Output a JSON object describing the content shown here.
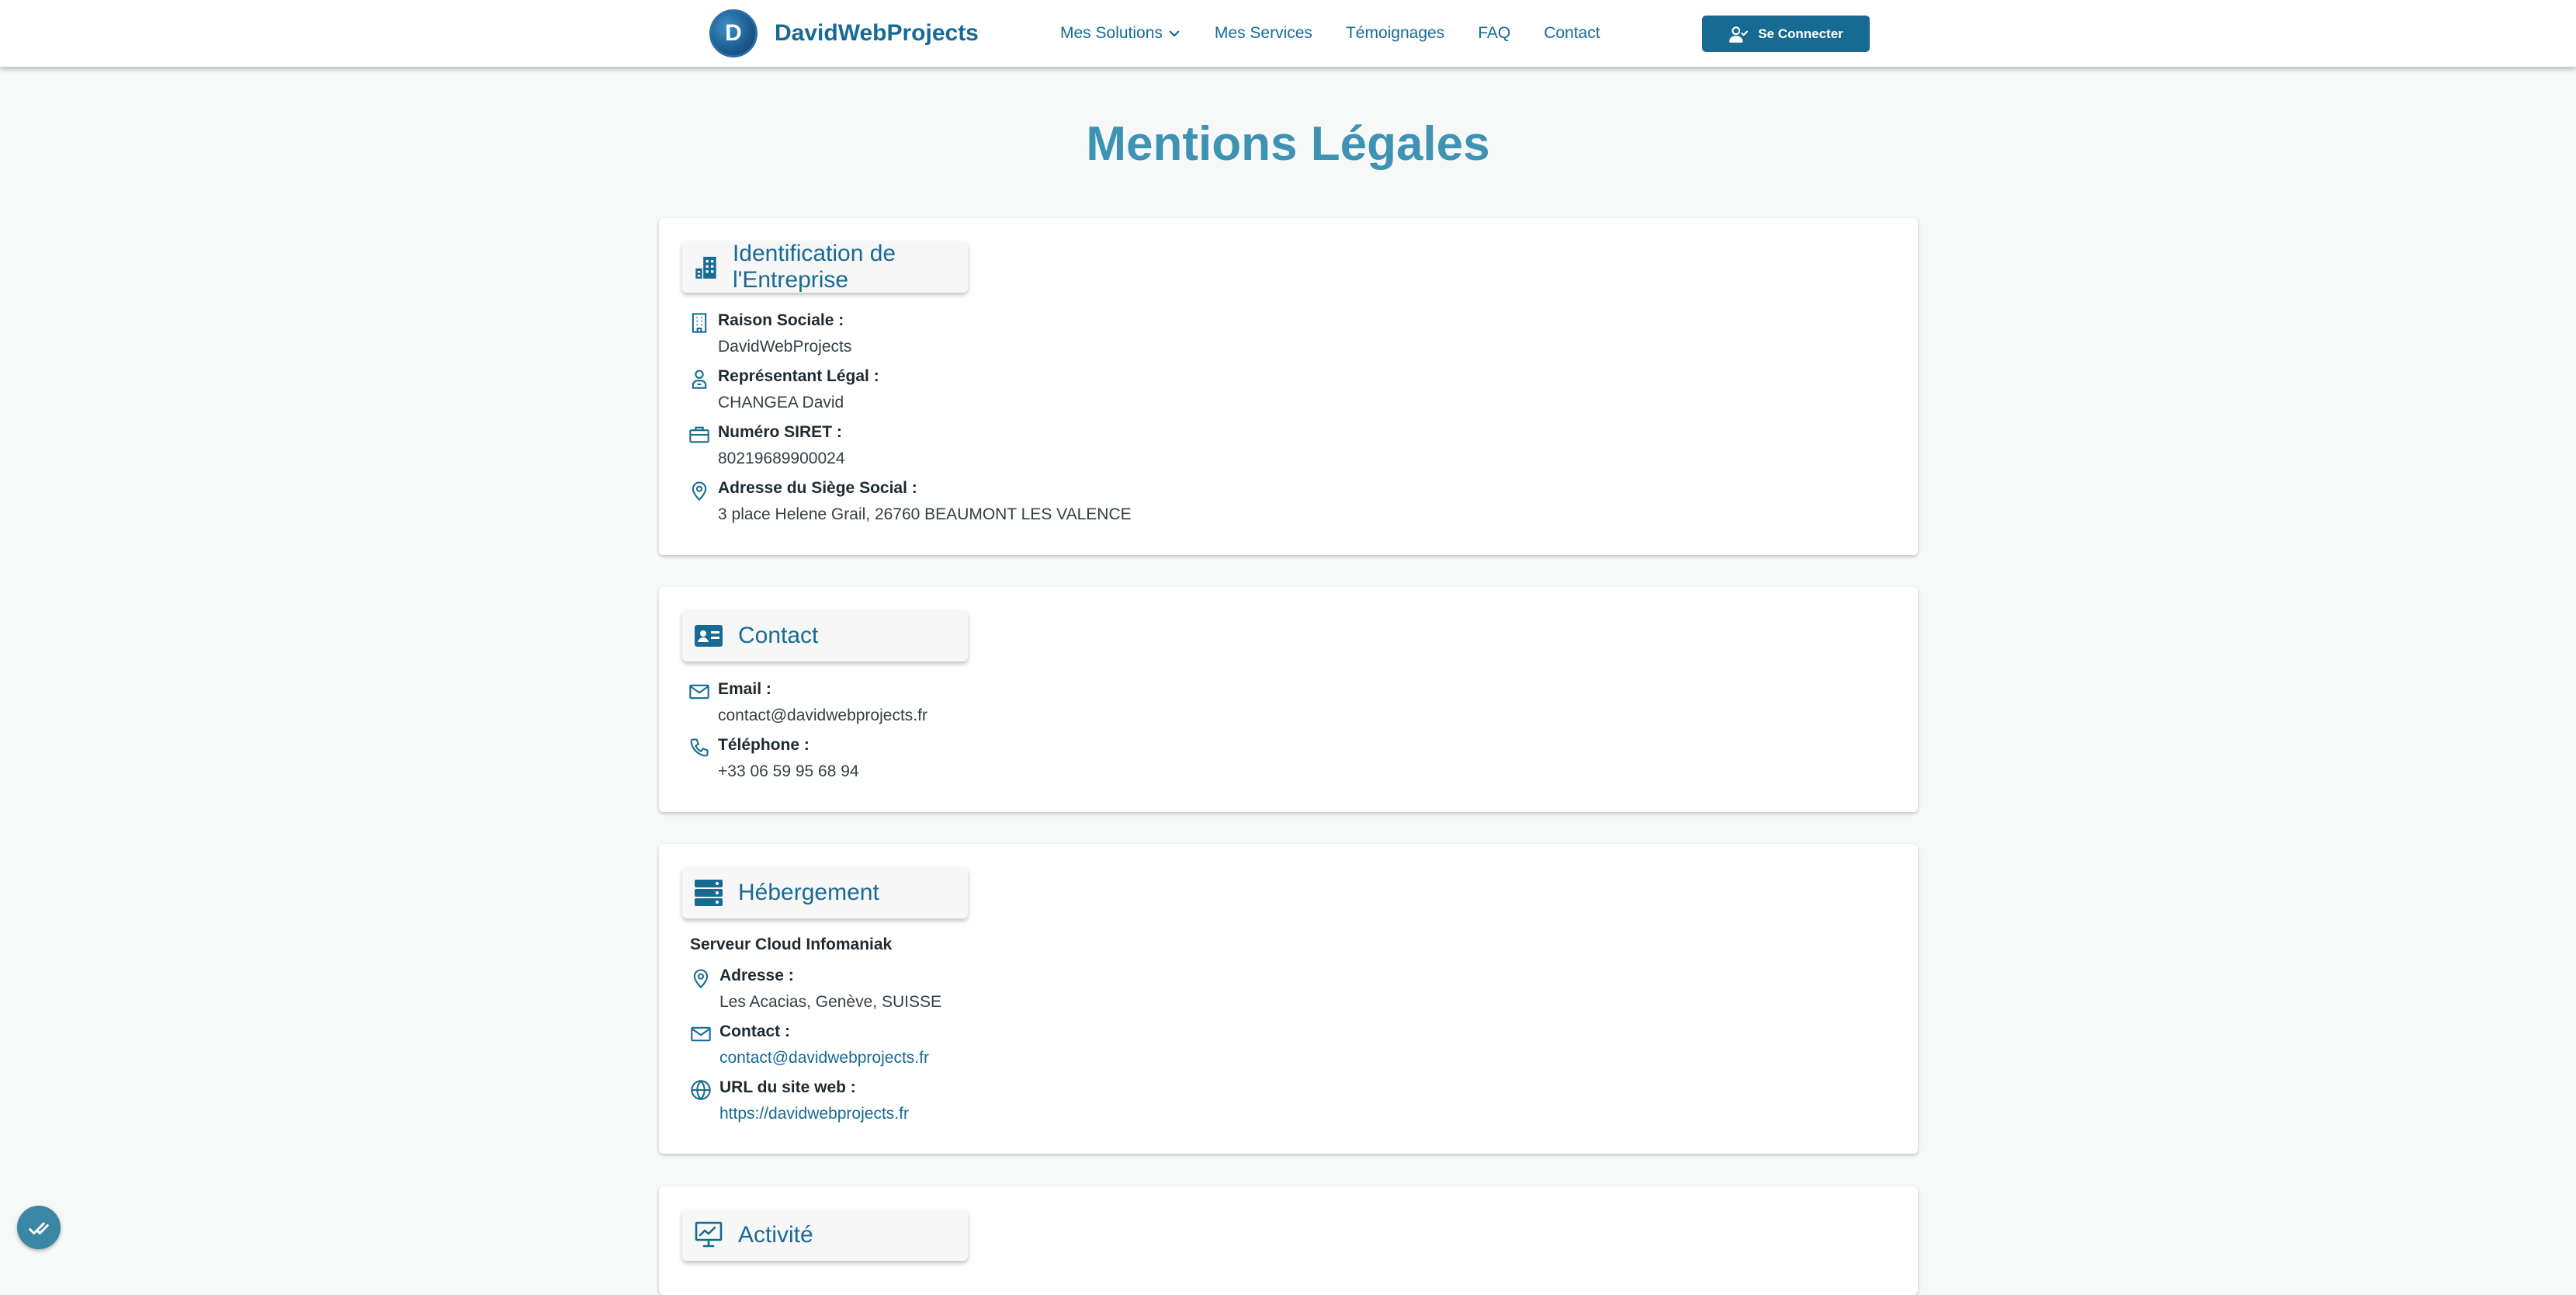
{
  "header": {
    "brand": "DavidWebProjects",
    "logo_letter": "D",
    "nav": {
      "solutions": "Mes Solutions",
      "services": "Mes Services",
      "testimonials": "Témoignages",
      "faq": "FAQ",
      "contact": "Contact"
    },
    "login_label": "Se Connecter"
  },
  "page": {
    "title": "Mentions Légales"
  },
  "identification": {
    "title": "Identification de l'Entreprise",
    "icon": "building-icon",
    "raison_label": "Raison Sociale :",
    "raison_value": "DavidWebProjects",
    "rep_label": "Représentant Légal :",
    "rep_value": "CHANGEA David",
    "siret_label": "Numéro SIRET :",
    "siret_value": "80219689900024",
    "address_label": "Adresse du Siège Social :",
    "address_value": "3 place Helene Grail, 26760 BEAUMONT LES VALENCE"
  },
  "contact": {
    "title": "Contact",
    "icon": "contact-card-icon",
    "email_label": "Email :",
    "email_value": "contact@davidwebprojects.fr",
    "phone_label": "Téléphone :",
    "phone_value": "+33 06 59 95 68 94"
  },
  "hosting": {
    "title": "Hébergement",
    "icon": "server-icon",
    "provider": "Serveur Cloud Infomaniak",
    "address_label": "Adresse :",
    "address_value": "Les Acacias, Genève, SUISSE",
    "contact_label": "Contact :",
    "contact_value": "contact@davidwebprojects.fr",
    "url_label": "URL du site web :",
    "url_value": "https://davidwebprojects.fr"
  },
  "activity": {
    "title": "Activité",
    "icon": "presentation-chart-icon"
  },
  "colors": {
    "primary": "#176b93",
    "title": "#3e93b3",
    "background": "#f7f9f9"
  }
}
